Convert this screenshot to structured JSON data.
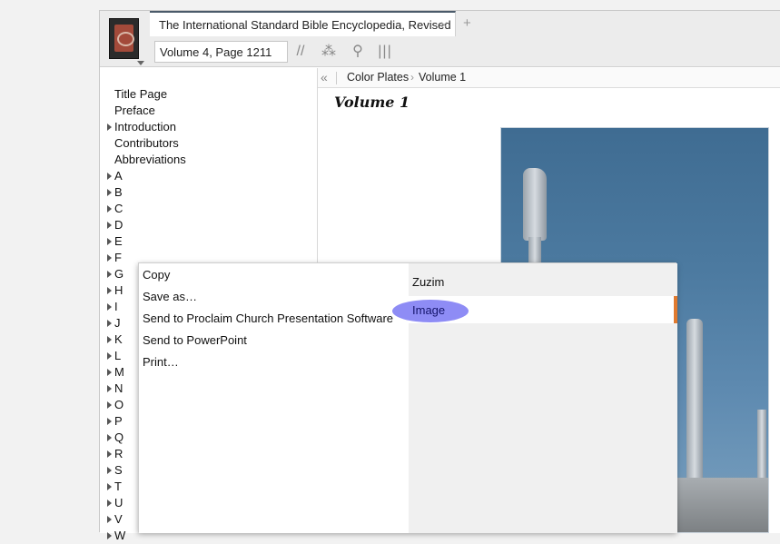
{
  "window": {
    "tab_title": "The International Standard Bible Encyclopedia, Revised",
    "tab_close": "×",
    "tab_add": "+",
    "reference": "Volume 4, Page 1211"
  },
  "toolbar": {
    "parallel_icon": "//",
    "visual_filter_icon": "⁂",
    "search_icon": "⚲",
    "columns_icon": "|||"
  },
  "toc": {
    "items": [
      {
        "label": "Title Page",
        "expandable": false
      },
      {
        "label": "Preface",
        "expandable": false
      },
      {
        "label": "Introduction",
        "expandable": true
      },
      {
        "label": "Contributors",
        "expandable": false
      },
      {
        "label": "Abbreviations",
        "expandable": false
      },
      {
        "label": "A",
        "expandable": true
      },
      {
        "label": "B",
        "expandable": true
      },
      {
        "label": "C",
        "expandable": true
      },
      {
        "label": "D",
        "expandable": true
      },
      {
        "label": "E",
        "expandable": true
      },
      {
        "label": "F",
        "expandable": true
      },
      {
        "label": "G",
        "expandable": true
      },
      {
        "label": "H",
        "expandable": true
      },
      {
        "label": "I",
        "expandable": true
      },
      {
        "label": "J",
        "expandable": true
      },
      {
        "label": "K",
        "expandable": true
      },
      {
        "label": "L",
        "expandable": true
      },
      {
        "label": "M",
        "expandable": true
      },
      {
        "label": "N",
        "expandable": true
      },
      {
        "label": "O",
        "expandable": true
      },
      {
        "label": "P",
        "expandable": true
      },
      {
        "label": "Q",
        "expandable": true
      },
      {
        "label": "R",
        "expandable": true
      },
      {
        "label": "S",
        "expandable": true
      },
      {
        "label": "T",
        "expandable": true
      },
      {
        "label": "U",
        "expandable": true
      },
      {
        "label": "V",
        "expandable": true
      },
      {
        "label": "W",
        "expandable": true
      }
    ]
  },
  "content": {
    "collapse": "«",
    "breadcrumb": [
      "Color Plates",
      "Volume 1"
    ],
    "breadcrumb_sep": "›",
    "heading": "Volume 1"
  },
  "context_menu": {
    "actions": [
      "Copy",
      "Save as…",
      "Send to Proclaim Church Presentation Software",
      "Send to PowerPoint",
      "Print…"
    ],
    "submenu_header": "Zuzim",
    "submenu_selected": "Image"
  },
  "colors": {
    "accent": "#e07a2f",
    "highlight": "#8e8cf5"
  }
}
